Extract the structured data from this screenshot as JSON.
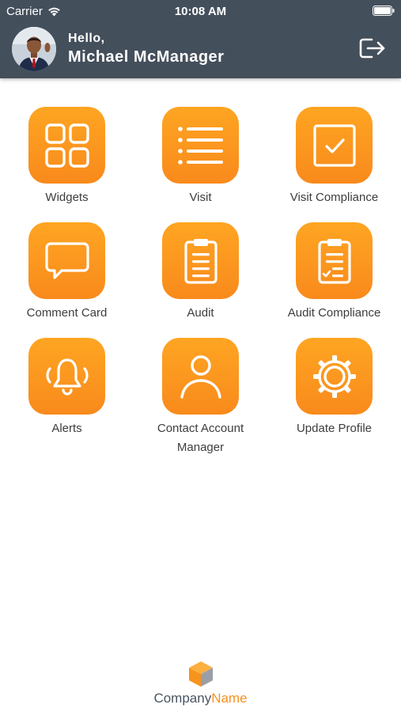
{
  "status_bar": {
    "carrier": "Carrier",
    "time": "10:08 AM"
  },
  "header": {
    "greeting": "Hello,",
    "user_name": "Michael McManager",
    "logout_icon": "logout-icon",
    "background_color": "#444f5c"
  },
  "tiles": [
    {
      "label": "Widgets",
      "icon": "widgets-grid-icon"
    },
    {
      "label": "Visit",
      "icon": "list-icon"
    },
    {
      "label": "Visit Compliance",
      "icon": "checkbox-icon"
    },
    {
      "label": "Comment Card",
      "icon": "comment-icon"
    },
    {
      "label": "Audit",
      "icon": "clipboard-icon"
    },
    {
      "label": "Audit Compliance",
      "icon": "clipboard-check-icon"
    },
    {
      "label": "Alerts",
      "icon": "bell-icon"
    },
    {
      "label": "Contact Account Manager",
      "icon": "person-icon"
    },
    {
      "label": "Update Profile",
      "icon": "gear-icon"
    }
  ],
  "accent_color": "#f98a1c",
  "footer": {
    "company": "Company",
    "suffix": "Name",
    "logo_icon": "cube-logo-icon"
  }
}
